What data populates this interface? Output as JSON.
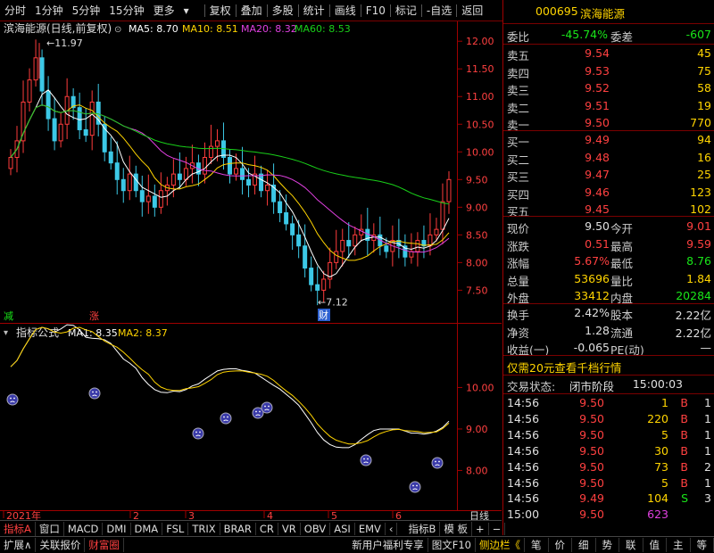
{
  "toolbar": {
    "left": [
      "分时",
      "1分钟",
      "5分钟",
      "15分钟",
      "更多"
    ],
    "more_arrow": "▾",
    "right": [
      "复权",
      "叠加",
      "多股",
      "统计",
      "画线",
      "F10",
      "标记",
      "-自选",
      "返回"
    ]
  },
  "stock": {
    "code": "000695",
    "name": "滨海能源"
  },
  "chart": {
    "title": "滨海能源(日线,前复权)",
    "ma": [
      {
        "label": "MA5: 8.70",
        "color": "#ffffff"
      },
      {
        "label": "MA10: 8.51",
        "color": "#ffd400"
      },
      {
        "label": "MA20: 8.32",
        "color": "#e040e0"
      },
      {
        "label": "MA60: 8.53",
        "color": "#19d019"
      }
    ],
    "yticks": [
      "12.00",
      "11.50",
      "11.00",
      "10.50",
      "10.00",
      "9.50",
      "9.00",
      "8.50",
      "8.00",
      "7.50"
    ],
    "high_label": "11.97",
    "low_label": "7.12",
    "tag_left": "减",
    "tag_mid": "涨",
    "tag_low": "财",
    "ind_title": "指标公式",
    "ind_ma1": "MA1: 8.35",
    "ind_ma2": "MA2: 8.37",
    "ind_yticks": [
      "10.00",
      "9.00",
      "8.00"
    ],
    "xaxis": [
      "2021年",
      "2",
      "3",
      "4",
      "5",
      "6"
    ],
    "xaxis_right": "日线"
  },
  "chart_data": {
    "type": "candlestick",
    "closes": [
      9.9,
      10.2,
      10.9,
      11.3,
      11.7,
      11.1,
      10.6,
      10.2,
      10.5,
      11.0,
      10.8,
      10.4,
      10.3,
      10.9,
      10.5,
      10.0,
      9.8,
      9.5,
      9.3,
      9.6,
      9.3,
      9.1,
      9.2,
      9.0,
      9.3,
      9.4,
      9.6,
      9.5,
      9.7,
      9.8,
      9.6,
      9.9,
      10.1,
      10.2,
      9.9,
      9.6,
      9.7,
      9.5,
      9.4,
      9.6,
      9.3,
      9.4,
      9.1,
      8.9,
      8.7,
      8.5,
      8.3,
      7.9,
      7.6,
      7.5,
      7.7,
      8.0,
      8.2,
      8.4,
      8.3,
      8.5,
      8.6,
      8.4,
      8.5,
      8.3,
      8.2,
      8.4,
      8.3,
      8.1,
      8.2,
      8.4,
      8.3,
      8.5,
      8.6,
      9.1,
      9.5
    ],
    "ma_series": [
      "MA5",
      "MA10",
      "MA20",
      "MA60"
    ]
  },
  "indicators": {
    "left": [
      "指标A",
      "窗口",
      "MACD",
      "DMI",
      "DMA",
      "FSL",
      "TRIX",
      "BRAR",
      "CR",
      "VR",
      "OBV",
      "ASI",
      "EMV",
      "‹"
    ],
    "right": [
      "指标B",
      "模 板",
      "+",
      "−"
    ]
  },
  "bottom": {
    "items": [
      "扩展∧",
      "关联报价",
      "财富圈"
    ],
    "right": [
      "新用户福利专享",
      "图文F10",
      "侧边栏《"
    ],
    "icons": [
      "笔",
      "价",
      "细",
      "势",
      "联",
      "值",
      "主",
      "等"
    ]
  },
  "quote": {
    "wb": {
      "l1": "委比",
      "v1": "-45.74%",
      "l2": "委差",
      "v2": "-607"
    },
    "asks": [
      {
        "l": "卖五",
        "p": "9.54",
        "v": "45"
      },
      {
        "l": "卖四",
        "p": "9.53",
        "v": "75"
      },
      {
        "l": "卖三",
        "p": "9.52",
        "v": "58"
      },
      {
        "l": "卖二",
        "p": "9.51",
        "v": "19"
      },
      {
        "l": "卖一",
        "p": "9.50",
        "v": "770"
      }
    ],
    "bids": [
      {
        "l": "买一",
        "p": "9.49",
        "v": "94"
      },
      {
        "l": "买二",
        "p": "9.48",
        "v": "16"
      },
      {
        "l": "买三",
        "p": "9.47",
        "v": "25"
      },
      {
        "l": "买四",
        "p": "9.46",
        "v": "123"
      },
      {
        "l": "买五",
        "p": "9.45",
        "v": "102"
      }
    ],
    "stats": [
      [
        "现价",
        "9.50",
        "今开",
        "9.01"
      ],
      [
        "涨跌",
        "0.51",
        "最高",
        "9.59"
      ],
      [
        "涨幅",
        "5.67%",
        "最低",
        "8.76"
      ],
      [
        "总量",
        "53696",
        "量比",
        "1.84"
      ],
      [
        "外盘",
        "33412",
        "内盘",
        "20284"
      ]
    ],
    "stats2": [
      [
        "换手",
        "2.42%",
        "股本",
        "2.22亿"
      ],
      [
        "净资",
        "1.28",
        "流通",
        "2.22亿"
      ],
      [
        "收益(一)",
        "-0.065",
        "PE(动)",
        "—"
      ]
    ],
    "promo": "仅需20元查看千档行情",
    "status_label": "交易状态:",
    "status": "闭市阶段",
    "status_time": "15:00:03",
    "ticks": [
      [
        "14:56",
        "9.50",
        "1",
        "B",
        "1"
      ],
      [
        "14:56",
        "9.50",
        "220",
        "B",
        "1"
      ],
      [
        "14:56",
        "9.50",
        "5",
        "B",
        "1"
      ],
      [
        "14:56",
        "9.50",
        "30",
        "B",
        "1"
      ],
      [
        "14:56",
        "9.50",
        "73",
        "B",
        "2"
      ],
      [
        "14:56",
        "9.50",
        "5",
        "B",
        "1"
      ],
      [
        "14:56",
        "9.49",
        "104",
        "S",
        "3"
      ],
      [
        "15:00",
        "9.50",
        "623",
        "",
        ""
      ]
    ]
  }
}
